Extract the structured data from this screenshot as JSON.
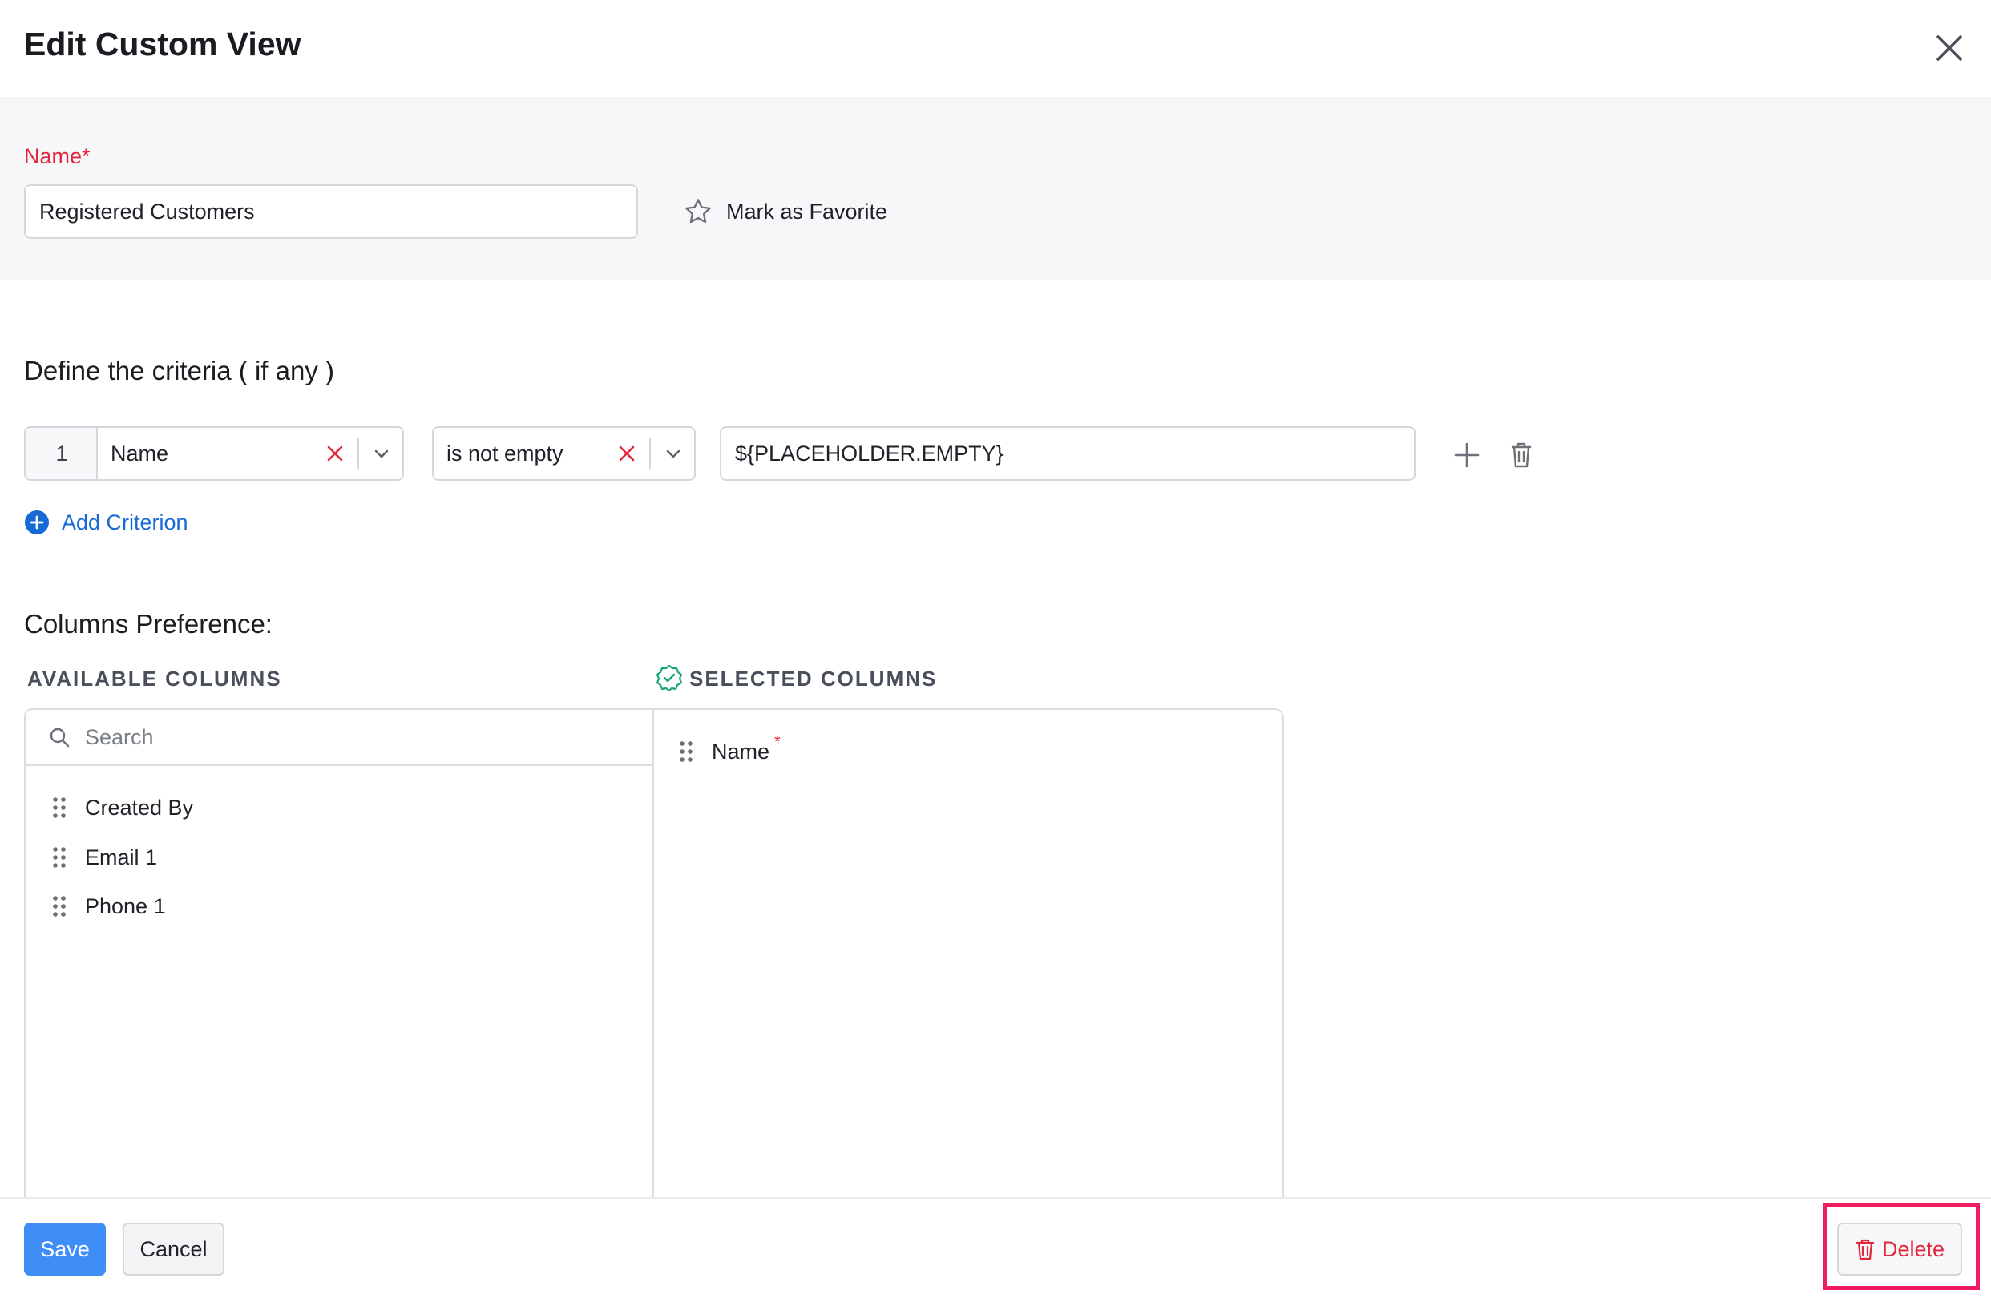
{
  "dialog": {
    "title": "Edit Custom View",
    "close_icon": "close-icon"
  },
  "name_section": {
    "label": "Name*",
    "value": "Registered Customers",
    "favorite_label": "Mark as Favorite",
    "favorite_icon": "star-outline-icon"
  },
  "criteria": {
    "heading": "Define the criteria ( if any )",
    "rows": [
      {
        "index": "1",
        "field": "Name",
        "operator": "is not empty",
        "value": "${PLACEHOLDER.EMPTY}"
      }
    ],
    "add_label": "Add Criterion"
  },
  "columns": {
    "heading": "Columns Preference:",
    "available_heading": "AVAILABLE COLUMNS",
    "selected_heading": "SELECTED COLUMNS",
    "search_placeholder": "Search",
    "available": [
      "Created By",
      "Email 1",
      "Phone 1"
    ],
    "selected": [
      {
        "label": "Name",
        "required_mark": "*"
      }
    ]
  },
  "footer": {
    "save_label": "Save",
    "cancel_label": "Cancel",
    "delete_label": "Delete"
  },
  "colors": {
    "primary": "#3f8ef7",
    "danger": "#e0263a",
    "link": "#1769d6",
    "highlight": "#ef1c5e",
    "success": "#1aa57a"
  }
}
